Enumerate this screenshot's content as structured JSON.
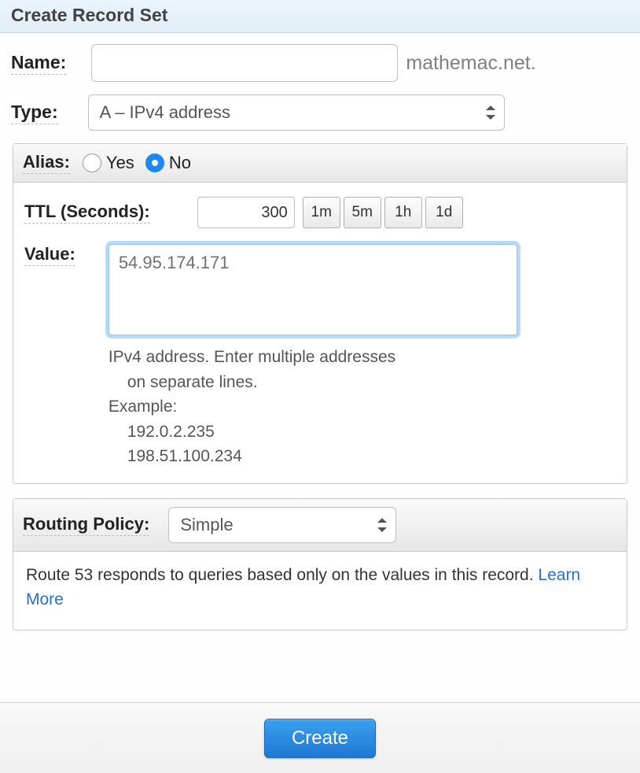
{
  "title": "Create Record Set",
  "name": {
    "label": "Name:",
    "value": "",
    "suffix": "mathemac.net."
  },
  "type": {
    "label": "Type:",
    "selected": "A – IPv4 address"
  },
  "alias": {
    "label": "Alias:",
    "yes_label": "Yes",
    "no_label": "No",
    "selected": "no"
  },
  "ttl": {
    "label": "TTL (Seconds):",
    "value": "300",
    "presets": [
      "1m",
      "5m",
      "1h",
      "1d"
    ]
  },
  "value": {
    "label": "Value:",
    "text": "54.95.174.171",
    "helper_line1": "IPv4 address. Enter multiple addresses",
    "helper_line1b": "on separate lines.",
    "helper_line2": "Example:",
    "helper_line3": "192.0.2.235",
    "helper_line4": "198.51.100.234"
  },
  "routing": {
    "label": "Routing Policy:",
    "selected": "Simple",
    "description": "Route 53 responds to queries based only on the values in this record. ",
    "learn_more": "Learn More"
  },
  "create_button": "Create"
}
